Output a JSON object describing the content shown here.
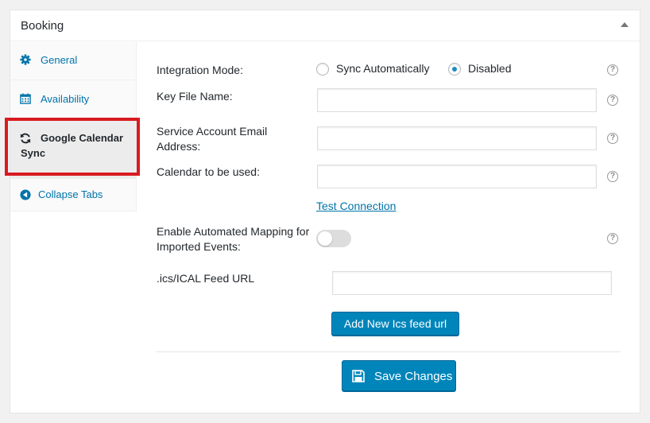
{
  "panel": {
    "title": "Booking"
  },
  "tabs": [
    {
      "label": "General",
      "icon": "gear-icon"
    },
    {
      "label": "Availability",
      "icon": "calendar-icon"
    },
    {
      "label": "Google Calendar Sync",
      "icon": "sync-icon",
      "active": true
    },
    {
      "label": "Collapse Tabs",
      "icon": "collapse-arrow-icon"
    }
  ],
  "form": {
    "integration_mode": {
      "label": "Integration Mode:",
      "options": [
        "Sync Automatically",
        "Disabled"
      ],
      "selected": "Disabled"
    },
    "key_file": {
      "label": "Key File Name:",
      "value": ""
    },
    "service_email": {
      "label": "Service Account Email Address:",
      "value": ""
    },
    "calendar": {
      "label": "Calendar to be used:",
      "value": ""
    },
    "test_connection": "Test Connection",
    "auto_mapping": {
      "label": "Enable Automated Mapping for Imported Events:",
      "enabled": false
    },
    "ics_feed": {
      "label": ".ics/ICAL Feed URL",
      "value": ""
    },
    "add_feed_button": "Add New Ics feed url",
    "save_button": "Save Changes",
    "help_glyph": "?"
  },
  "colors": {
    "accent": "#0085ba",
    "link": "#0073aa",
    "highlight": "#d81b21"
  }
}
